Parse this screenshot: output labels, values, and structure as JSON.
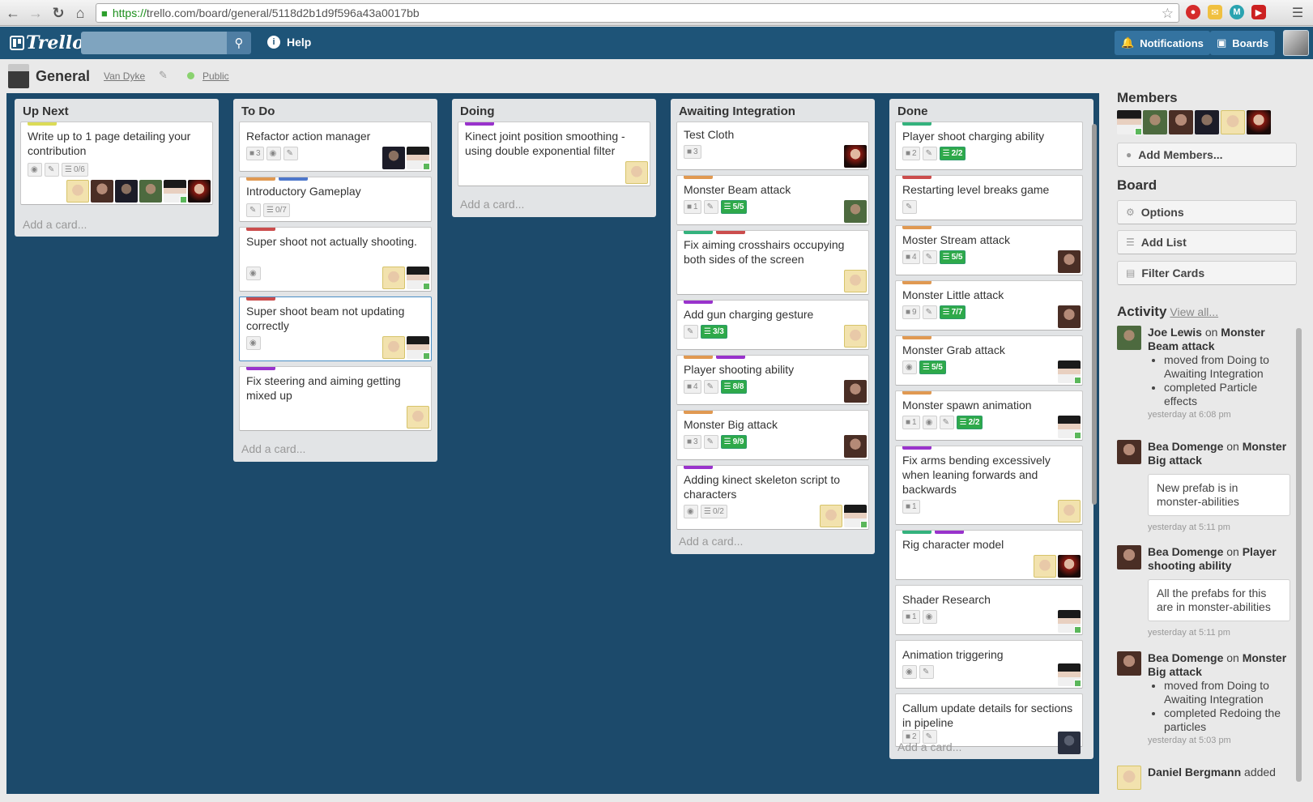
{
  "browser": {
    "url_scheme": "https://",
    "url_rest": "trello.com/board/general/5118d2b1d9f596a43a0017bb"
  },
  "header": {
    "logo": "Trello",
    "help": "Help",
    "notifications": "Notifications",
    "boards": "Boards"
  },
  "board": {
    "title": "General",
    "org": "Van Dyke",
    "visibility": "Public"
  },
  "lists": [
    {
      "title": "Up Next",
      "add_card": "Add a card...",
      "cards": [
        {
          "title": "Write up to 1 page detailing your contribution",
          "checklist": "0/6"
        }
      ]
    },
    {
      "title": "To Do",
      "add_card": "Add a card...",
      "cards": [
        {
          "title": "Refactor action manager",
          "comments": "3"
        },
        {
          "title": "Introductory Gameplay",
          "checklist": "0/7"
        },
        {
          "title": "Super shoot not actually shooting."
        },
        {
          "title": "Super shoot beam not updating correctly"
        },
        {
          "title": "Fix steering and aiming getting mixed up"
        }
      ]
    },
    {
      "title": "Doing",
      "add_card": "Add a card...",
      "cards": [
        {
          "title": "Kinect joint position smoothing - using double exponential filter"
        }
      ]
    },
    {
      "title": "Awaiting Integration",
      "add_card": "Add a card...",
      "cards": [
        {
          "title": "Test Cloth",
          "comments": "3"
        },
        {
          "title": "Monster Beam attack",
          "comments": "1",
          "checklist": "5/5"
        },
        {
          "title": "Fix aiming crosshairs occupying both sides of the screen"
        },
        {
          "title": "Add gun charging gesture",
          "checklist": "3/3"
        },
        {
          "title": "Player shooting ability",
          "comments": "4",
          "checklist": "8/8"
        },
        {
          "title": "Monster Big attack",
          "comments": "3",
          "checklist": "9/9"
        },
        {
          "title": "Adding kinect skeleton script to characters",
          "checklist": "0/2"
        }
      ]
    },
    {
      "title": "Done",
      "add_card": "Add a card...",
      "cards": [
        {
          "title": "Player shoot charging ability",
          "comments": "2",
          "checklist": "2/2"
        },
        {
          "title": "Restarting level breaks game"
        },
        {
          "title": "Moster Stream attack",
          "comments": "4",
          "checklist": "5/5"
        },
        {
          "title": "Monster Little attack",
          "comments": "9",
          "checklist": "7/7"
        },
        {
          "title": "Monster Grab attack",
          "checklist": "5/5"
        },
        {
          "title": "Monster spawn animation",
          "comments": "1",
          "checklist": "2/2"
        },
        {
          "title": "Fix arms bending excessively when leaning forwards and backwards",
          "comments": "1"
        },
        {
          "title": "Rig character model"
        },
        {
          "title": "Shader Research",
          "comments": "1"
        },
        {
          "title": "Animation triggering"
        },
        {
          "title": "Callum update details for sections in pipeline",
          "comments": "2"
        }
      ]
    }
  ],
  "sidebar": {
    "members_title": "Members",
    "add_members": "Add Members...",
    "board_title": "Board",
    "options": "Options",
    "add_list": "Add List",
    "filter_cards": "Filter Cards",
    "activity_title": "Activity",
    "view_all": "View all...",
    "activity": [
      {
        "user": "Joe Lewis",
        "on": "on",
        "target": "Monster Beam attack",
        "items": [
          "moved from Doing to Awaiting Integration",
          "completed Particle effects"
        ],
        "time": "yesterday at 6:08 pm"
      },
      {
        "user": "Bea Domenge",
        "on": "on",
        "target": "Monster Big attack",
        "comment": "New prefab is in monster-abilities",
        "time": "yesterday at 5:11 pm"
      },
      {
        "user": "Bea Domenge",
        "on": "on",
        "target": "Player shooting ability",
        "comment": "All the prefabs for this are in monster-abilities",
        "time": "yesterday at 5:11 pm"
      },
      {
        "user": "Bea Domenge",
        "on": "on",
        "target": "Monster Big attack",
        "items": [
          "moved from Doing to Awaiting Integration",
          "completed Redoing the particles"
        ],
        "time": "yesterday at 5:03 pm"
      },
      {
        "user": "Daniel Bergmann",
        "text": "added"
      }
    ]
  },
  "colors": {
    "header": "#1e5478",
    "canvas": "#1c4a6b",
    "label_green": "#34b27d",
    "label_yellow": "#dbdb57",
    "label_orange": "#e09952",
    "label_red": "#cb4d4d",
    "label_purple": "#93c",
    "label_blue": "#4d77cb",
    "checklist_done": "#2ea94a"
  }
}
